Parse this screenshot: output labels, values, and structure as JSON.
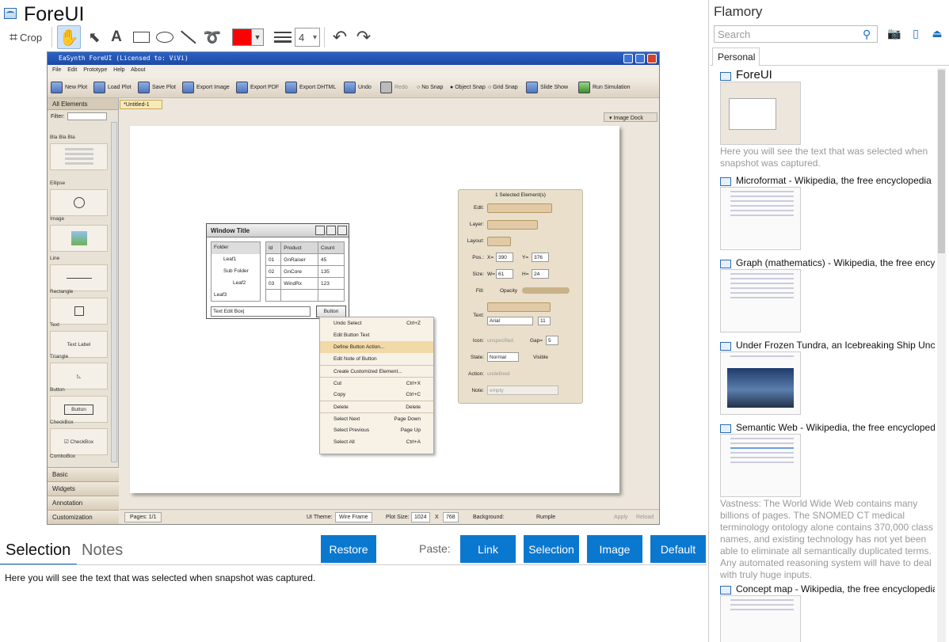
{
  "app": {
    "title": "ForeUI"
  },
  "toolbar": {
    "crop_label": "Crop",
    "line_width": "4",
    "color": "#ff0000"
  },
  "shot": {
    "title": "EaSynth ForeUI (Licensed to: ViVi)",
    "menu": [
      "File",
      "Edit",
      "Prototype",
      "Help",
      "About"
    ],
    "tools": [
      "New Plot",
      "Load Plot",
      "Save Plot",
      "Export Image",
      "Export PDF",
      "Export DHTML",
      "Undo",
      "Redo",
      "No Snap",
      "Object Snap",
      "Grid Snap",
      "Slide Show",
      "Run Simulation"
    ],
    "left_head": "All Elements",
    "filter_label": "Filter:",
    "palette": [
      {
        "name": "Bla Bla Bla",
        "preview": ""
      },
      {
        "name": "Ellipse",
        "preview": ""
      },
      {
        "name": "Image",
        "preview": ""
      },
      {
        "name": "Line",
        "preview": ""
      },
      {
        "name": "Rectangle",
        "preview": ""
      },
      {
        "name": "Text",
        "preview": "Text Label"
      },
      {
        "name": "Triangle",
        "preview": ""
      },
      {
        "name": "Button",
        "preview": "Button"
      },
      {
        "name": "CheckBox",
        "preview": "CheckBox"
      },
      {
        "name": "ComboBox",
        "preview": ""
      }
    ],
    "accordion": [
      "Basic",
      "Widgets",
      "Annotation",
      "Customization"
    ],
    "tab": "*Untitled-1",
    "dock": "Image Dock",
    "window": {
      "title": "Window Title",
      "tree": [
        "Folder",
        "Leaf1",
        "Sub Folder",
        "Leaf2",
        "Leaf3"
      ],
      "columns": [
        "Id",
        "Product",
        "Count"
      ],
      "rows": [
        [
          "01",
          "GnRaiser",
          "45"
        ],
        [
          "02",
          "GnCore",
          "135"
        ],
        [
          "03",
          "WindRx",
          "123"
        ]
      ],
      "text_edit": "Text Edit Box|",
      "button": "Button"
    },
    "context_menu": [
      {
        "label": "Undo Select",
        "key": "Ctrl+Z"
      },
      {
        "label": "Edit Button Text",
        "key": ""
      },
      {
        "label": "Define Button Action...",
        "key": ""
      },
      {
        "label": "Edit Note of Button",
        "key": ""
      },
      {
        "label": "Create Customized Element...",
        "key": ""
      },
      {
        "label": "Cut",
        "key": "Ctrl+X"
      },
      {
        "label": "Copy",
        "key": "Ctrl+C"
      },
      {
        "label": "Delete",
        "key": "Delete"
      },
      {
        "label": "Select Next",
        "key": "Page Down"
      },
      {
        "label": "Select Previous",
        "key": "Page Up"
      },
      {
        "label": "Select All",
        "key": "Ctrl+A"
      }
    ],
    "props": {
      "header": "1 Selected Element(s)",
      "edit": "Edit:",
      "layer": "Layer:",
      "layout": "Layout:",
      "pos": "Pos.:",
      "x_label": "X=",
      "x": "390",
      "y_label": "Y=",
      "y": "376",
      "size": "Size:",
      "w_label": "W=",
      "w": "61",
      "h_label": "H=",
      "h": "24",
      "fill": "Fill:",
      "opacity": "Opacity",
      "text": "Text:",
      "font": "Arial",
      "font_size": "11",
      "icon": "Icon:",
      "icon_value": "unspecified",
      "gap_label": "Gap=",
      "gap": "5",
      "state": "State:",
      "state_value": "Normal",
      "visible": "Visible",
      "action": "Action:",
      "action_value": "undefined",
      "note": "Note:",
      "note_value": "empty"
    },
    "status": {
      "pages": "Pages: 1/1",
      "theme_label": "UI Theme:",
      "theme": "Wire Frame",
      "size_label": "Plot Size:",
      "width": "1024",
      "x": "X",
      "height": "768",
      "bg_label": "Background:",
      "rumple": "Rumple",
      "apply": "Apply",
      "reload": "Reload"
    }
  },
  "bottom": {
    "tab_selection": "Selection",
    "tab_notes": "Notes",
    "restore": "Restore",
    "paste_label": "Paste:",
    "paste": [
      "Link",
      "Selection",
      "Image",
      "Default"
    ],
    "selection_text": "Here you will see the text that was selected when snapshot was captured."
  },
  "flamory": {
    "title": "Flamory",
    "search_placeholder": "Search",
    "tab": "Personal",
    "entries": [
      {
        "title": "ForeUI",
        "desc": "Here you will see the text that was selected when snapshot was captured."
      },
      {
        "title": "Microformat - Wikipedia, the free encyclopedia",
        "desc": ""
      },
      {
        "title": "Graph (mathematics) - Wikipedia, the free ency",
        "desc": ""
      },
      {
        "title": "Under Frozen Tundra, an Icebreaking Ship Unco",
        "desc": ""
      },
      {
        "title": "Semantic Web - Wikipedia, the free encycloped",
        "desc": "Vastness: The World Wide Web contains many billions of pages. The SNOMED CT medical terminology ontology alone contains 370,000 class names, and existing technology has not yet been able to eliminate all semantically duplicated terms. Any automated reasoning system will have to deal with truly huge inputs."
      },
      {
        "title": "Concept map - Wikipedia, the free encyclopedia",
        "desc": ""
      }
    ]
  }
}
